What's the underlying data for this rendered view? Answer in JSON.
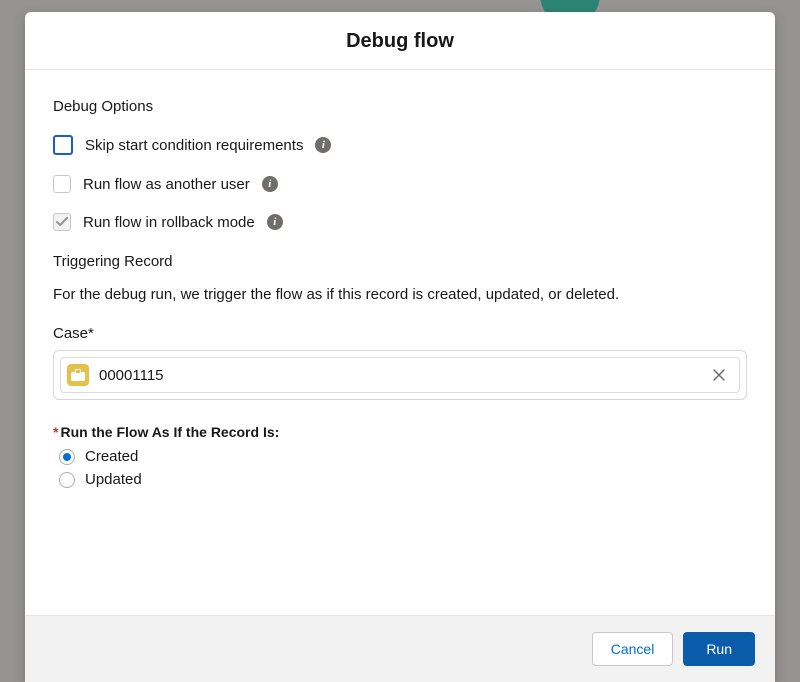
{
  "modal": {
    "title": "Debug flow",
    "options": {
      "section_title": "Debug Options",
      "skip_start": "Skip start condition requirements",
      "run_as_user": "Run flow as another user",
      "rollback": "Run flow in rollback mode"
    },
    "trigger": {
      "section_title": "Triggering Record",
      "description": "For the debug run, we trigger the flow as if this record is created, updated, or deleted.",
      "case_label": "Case*",
      "case_value": "00001115"
    },
    "mode": {
      "label": "Run the Flow As If the Record Is:",
      "created": "Created",
      "updated": "Updated"
    },
    "footer": {
      "cancel": "Cancel",
      "run": "Run"
    }
  }
}
